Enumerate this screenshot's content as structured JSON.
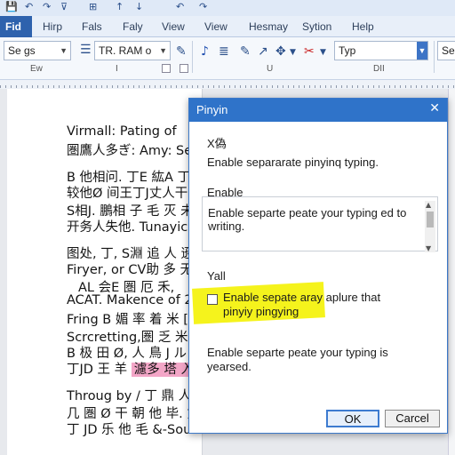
{
  "quick_access": {
    "icons": [
      "save-icon",
      "undo-icon",
      "redo-icon",
      "quick-access-dropdown-icon"
    ],
    "glyphs": [
      "💾",
      "↶",
      "↷",
      "⊽"
    ]
  },
  "tabs": [
    {
      "label": "Fid",
      "active": true
    },
    {
      "label": "Hirp"
    },
    {
      "label": "Fals"
    },
    {
      "label": "Faly"
    },
    {
      "label": "View"
    },
    {
      "label": "View"
    },
    {
      "label": "Hesmay"
    },
    {
      "label": "Sytion"
    },
    {
      "label": "Help"
    }
  ],
  "toolbar": {
    "style_combo": "Se gs",
    "font_combo": "TR. RAM o",
    "lang_combo": "Typ",
    "right_combo": "Sei",
    "labels": {
      "left": "Ew",
      "middle1": "I",
      "middle2": "U",
      "right": "DII"
    }
  },
  "document": {
    "lines": [
      "Virmall: Pating of",
      "圏鷹人多ぎ: Amy: Serv",
      "B 他相问. 丁E 紘A 丁C",
      "较他Ø 间王丁J丈人干名",
      "S相J. 鵬相 子 毛 灭 未",
      "开务人失他. Tunayick.",
      "图处, 丁, S淵 追 人 逊",
      "Firyer, or CV助 多 无,",
      "AL 会E 圏 厄 禾,",
      "ACAT. Makence of 2.",
      "Fring B 媚 率 着 米 [",
      "Scrcretting,圏 乏 米 贝.",
      "B 极 田 Ø, 人 鳥 J ル 丁",
      "丁JD 王 羊",
      "Throug by / 丁 鼎 人 S",
      "几 圏 Ø 干 朝 他 毕. 丈 丁",
      "丁 JD 乐 他 毛 &-Southe"
    ],
    "highlight": "濾多 塔 入 扔"
  },
  "dialog": {
    "title": "Pinyin",
    "section1_label": "X偽",
    "section1_text": "Enable separarate pinyinq typing.",
    "section2_label": "Enable",
    "section2_text": "Enable separte peate your typing ed to writing.",
    "section3_label": "Yall",
    "checkbox_label": "Enable sepate aray aplure that pinyiy pingying",
    "section4_text": "Enable separte peate your typing is yearsed.",
    "ok_label": "OK",
    "cancel_label": "Carcel",
    "colors": {
      "title_bar": "#2f73c9",
      "highlight": "#f5f31c"
    }
  }
}
